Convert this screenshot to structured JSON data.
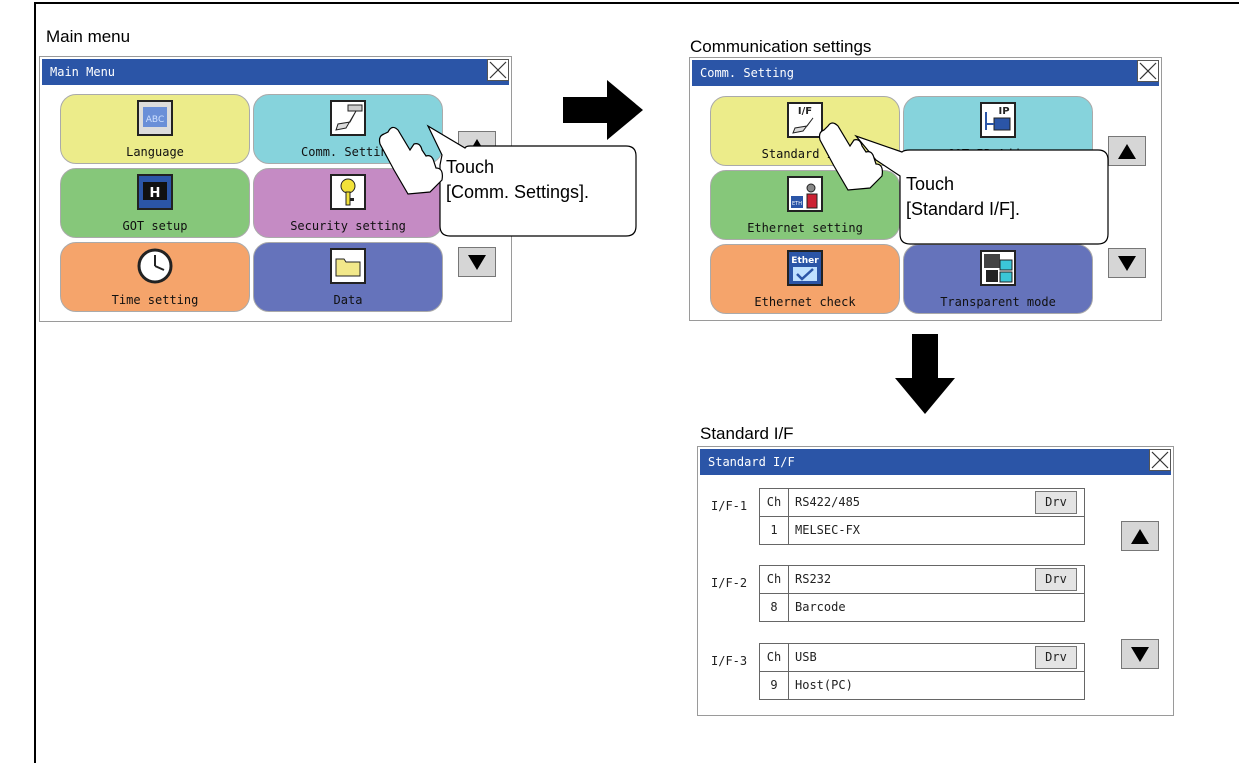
{
  "captions": {
    "main_menu": "Main menu",
    "comm_settings": "Communication settings",
    "standard_if": "Standard I/F"
  },
  "main_menu": {
    "title": "Main Menu",
    "tiles": [
      {
        "label": "Language",
        "color": "#ecec8a",
        "icon": "language-icon"
      },
      {
        "label": "Comm. Setting",
        "color": "#86d3dc",
        "icon": "comm-setting-icon"
      },
      {
        "label": "GOT setup",
        "color": "#86c77a",
        "icon": "got-setup-icon"
      },
      {
        "label": "Security setting",
        "color": "#c58bc4",
        "icon": "key-icon"
      },
      {
        "label": "Time setting",
        "color": "#f5a46b",
        "icon": "clock-icon"
      },
      {
        "label": "Data",
        "color": "#6573bb",
        "icon": "folder-icon"
      }
    ],
    "callout_line1": "Touch",
    "callout_line2": "[Comm. Settings]."
  },
  "comm_setting": {
    "title": "Comm. Setting",
    "tiles": [
      {
        "label": "Standard I/F",
        "color": "#ecec8a",
        "icon": "standard-if-icon"
      },
      {
        "label": "GOT IP Address",
        "color": "#86d3dc",
        "icon": "ip-address-icon"
      },
      {
        "label": "Ethernet setting",
        "color": "#86c77a",
        "icon": "ethernet-setting-icon"
      },
      {
        "label": "",
        "color": "#c58bc4",
        "icon": ""
      },
      {
        "label": "Ethernet check",
        "color": "#f5a46b",
        "icon": "ethernet-check-icon"
      },
      {
        "label": "Transparent mode",
        "color": "#6573bb",
        "icon": "transparent-mode-icon"
      }
    ],
    "callout_line1": "Touch",
    "callout_line2": "[Standard I/F]."
  },
  "standard_if": {
    "title": "Standard I/F",
    "rows": [
      {
        "if": "I/F-1",
        "ch_head": "Ch",
        "type": "RS422/485",
        "drv": "Drv",
        "ch": "1",
        "driver": "MELSEC-FX"
      },
      {
        "if": "I/F-2",
        "ch_head": "Ch",
        "type": "RS232",
        "drv": "Drv",
        "ch": "8",
        "driver": "Barcode"
      },
      {
        "if": "I/F-3",
        "ch_head": "Ch",
        "type": "USB",
        "drv": "Drv",
        "ch": "9",
        "driver": "Host(PC)"
      }
    ]
  },
  "colors": {
    "titlebar": "#2b55a7",
    "arrow": "#000000"
  }
}
